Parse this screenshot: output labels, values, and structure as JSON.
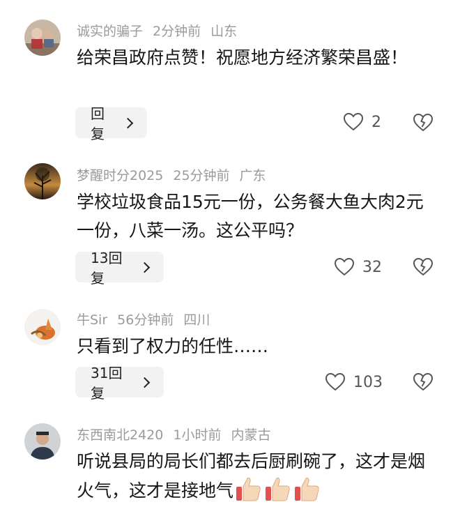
{
  "comments": [
    {
      "username": "诚实的骗子",
      "time": "2分钟前",
      "location": "山东",
      "text": "给荣昌政府点赞！祝愿地方经济繁荣昌盛！",
      "reply_label": "回复",
      "likes": "2"
    },
    {
      "username": "梦醒时分2025",
      "time": "25分钟前",
      "location": "广东",
      "text": "学校垃圾食品15元一份，公务餐大鱼大肉2元一份，八菜一汤。这公平吗？",
      "reply_label": "13回复",
      "likes": "32"
    },
    {
      "username": "牛Sir",
      "time": "56分钟前",
      "location": "四川",
      "text": "只看到了权力的任性……",
      "reply_label": "31回复",
      "likes": "103"
    },
    {
      "username": "东西南北2420",
      "time": "1小时前",
      "location": "内蒙古",
      "text": "听说县局的局长们都去后厨刷碗了，这才是烟火气，这才是接地气"
    }
  ],
  "icons": {
    "like": "heart-outline-icon",
    "dislike": "broken-heart-icon",
    "reply_chevron": "chevron-right-icon",
    "thumbs_emoji": "thumbs-up-emoji"
  },
  "colors": {
    "meta_text": "#9a9a9a",
    "button_bg": "#f2f2f2"
  }
}
